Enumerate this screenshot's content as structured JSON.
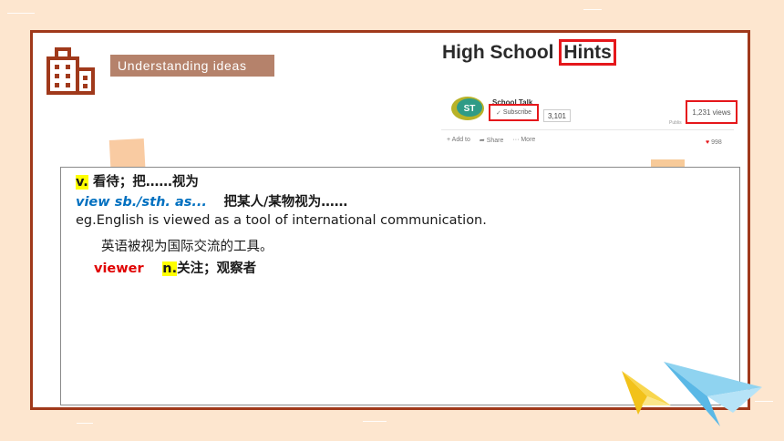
{
  "slide": {
    "section_tag": "Understanding ideas",
    "colors": {
      "background": "#fde6cf",
      "frame": "#a0391b",
      "tag_bg": "#b5826b",
      "highlight": "#ffff00",
      "phrase_blue": "#0070c0",
      "word_red": "#e00000",
      "screenshot_box_red": "#e5171b"
    },
    "icons": [
      "building-icon",
      "paper-plane-icon"
    ]
  },
  "screenshot": {
    "title_prefix": "High School",
    "title_boxed": "Hints",
    "channel_name": "School Talk",
    "logo_text": "ST",
    "subscribe_label": "Subscribe",
    "subscriber_count": "3,101",
    "views": "1,231 views",
    "published": "Publis",
    "actions": [
      "+ Add to",
      "Share",
      "··· More"
    ],
    "likes": "998"
  },
  "content": {
    "pos": "v.",
    "pos_meaning": " 看待；把……视为",
    "phrase": "view sb./sth. as...",
    "phrase_meaning": "把某人/某物视为……",
    "example_en": "eg.English is viewed as a tool of international communication.",
    "example_cn": "英语被视为国际交流的工具。",
    "derived_word": "viewer",
    "derived_pos": "n.",
    "derived_meaning": "关注；观察者"
  }
}
